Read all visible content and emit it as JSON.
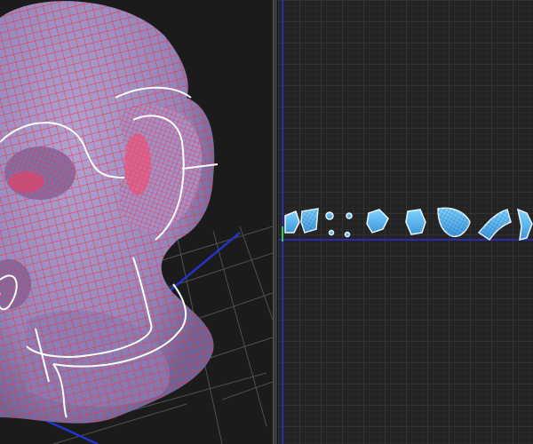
{
  "viewport_3d": {
    "model": "sculpted-head-mesh",
    "mesh_fill_color": "#9a8bbf",
    "wire_color": "#ff2a3a",
    "seam_color": "#ffffff",
    "grid_color": "#5a5a5a",
    "axis_color": "#2233cc"
  },
  "uv_editor": {
    "background_color": "#222222",
    "grid_color": "#3a3a3a",
    "axis_color": "#2a2aaa",
    "island_color": "#5ab8f0",
    "island_count": 11
  }
}
